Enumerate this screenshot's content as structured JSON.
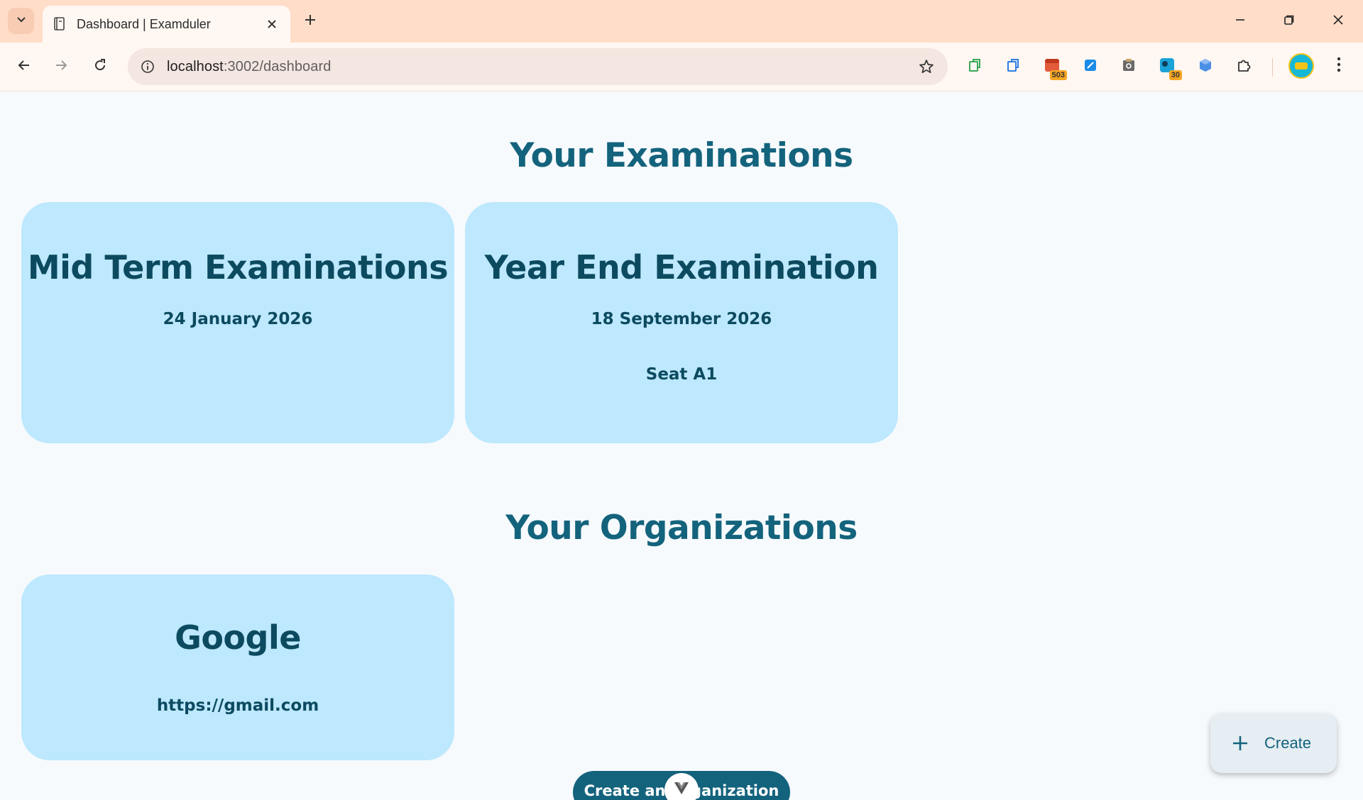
{
  "browser": {
    "tab": {
      "title": "Dashboard | Examduler"
    },
    "omnibox": {
      "url_host": "localhost",
      "url_rest": ":3002/dashboard"
    },
    "extensions": [
      {
        "icon": "green-square-extension-icon"
      },
      {
        "icon": "blue-square-extension-icon"
      },
      {
        "icon": "calendar-extension-icon",
        "badge": "503"
      },
      {
        "icon": "blue-pen-extension-icon"
      },
      {
        "icon": "clipboard-extension-icon"
      },
      {
        "icon": "chat-extension-icon",
        "badge": "30"
      },
      {
        "icon": "blue-cube-extension-icon"
      },
      {
        "icon": "puzzle-extensions-icon"
      }
    ],
    "colors": {
      "tabstrip": "#ffddc9",
      "toolbar": "#fff7f2",
      "omnibox": "#f4e6e0"
    }
  },
  "page": {
    "examinations_heading": "Your Examinations",
    "examinations": [
      {
        "title": "Mid Term Examinations",
        "date": "24 January 2026",
        "seat": ""
      },
      {
        "title": "Year End Examination",
        "date": "18 September 2026",
        "seat": "Seat A1"
      }
    ],
    "organizations_heading": "Your Organizations",
    "organizations": [
      {
        "name": "Google",
        "url": "https://gmail.com"
      }
    ],
    "create_org_label": "Create an Organization",
    "fab_label": "Create",
    "colors": {
      "background": "#f6fafd",
      "card": "#bde8fd",
      "accent": "#14637d",
      "card_text": "#0c4a60"
    }
  }
}
